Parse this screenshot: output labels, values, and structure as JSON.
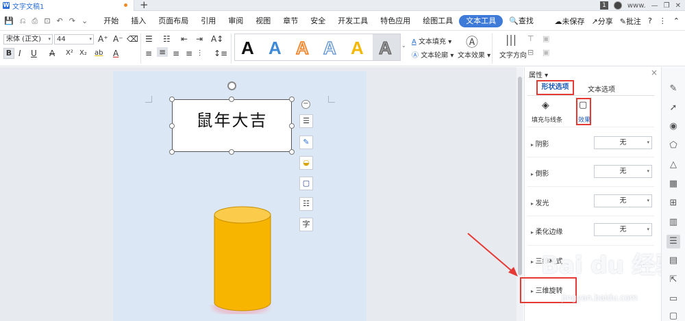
{
  "titlebar": {
    "doc_icon": "W",
    "doc_name": "文字文稿1",
    "add_tab": "+",
    "page_count": "1",
    "site": "www."
  },
  "quick_access": [
    "💾",
    "⎌",
    "⎙",
    "⊡",
    "↶",
    "↷",
    "⌄"
  ],
  "menu": {
    "items": [
      "开始",
      "插入",
      "页面布局",
      "引用",
      "审阅",
      "视图",
      "章节",
      "安全",
      "开发工具",
      "特色应用",
      "绘图工具",
      "文本工具"
    ],
    "active": "文本工具",
    "search_label": "查找",
    "unsaved_label": "未保存",
    "share_label": "分享",
    "annotate_label": "批注",
    "help": "?"
  },
  "ribbon": {
    "font_name": "宋体 (正文)",
    "font_size": "44",
    "bold": "B",
    "italic": "I",
    "underline": "U",
    "strike": "A",
    "superscript": "X²",
    "subscript": "X₂",
    "highlight": "ab",
    "font_color": "A",
    "text_fill": "文本填充",
    "text_outline": "文本轮廓",
    "text_effect": "文本效果",
    "text_direction": "文字方向",
    "style_letter": "A"
  },
  "document": {
    "textbox_text": "鼠年大吉",
    "float_tools": [
      "layout-icon",
      "pen-icon",
      "fill-icon",
      "border-icon",
      "wrap-icon",
      "char-icon"
    ],
    "float_char": "字"
  },
  "panel": {
    "title": "属性",
    "close": "×",
    "tab_shape": "形状选项",
    "tab_text": "文本选项",
    "sub_fill": "填充与线条",
    "sub_effect": "效果",
    "props": [
      {
        "label": "阴影",
        "value": "无"
      },
      {
        "label": "倒影",
        "value": "无"
      },
      {
        "label": "发光",
        "value": "无"
      },
      {
        "label": "柔化边缘",
        "value": "无"
      }
    ],
    "format3d": "三维格式",
    "rotation3d": "三维旋转"
  },
  "watermark": {
    "brand": "Bai du 经验",
    "url": "jingyan.baidu.com"
  },
  "colors": {
    "accent": "#3e7bd8",
    "highlight_red": "#e53935",
    "cylinder": "#f7b500",
    "page": "#dce7f5"
  }
}
